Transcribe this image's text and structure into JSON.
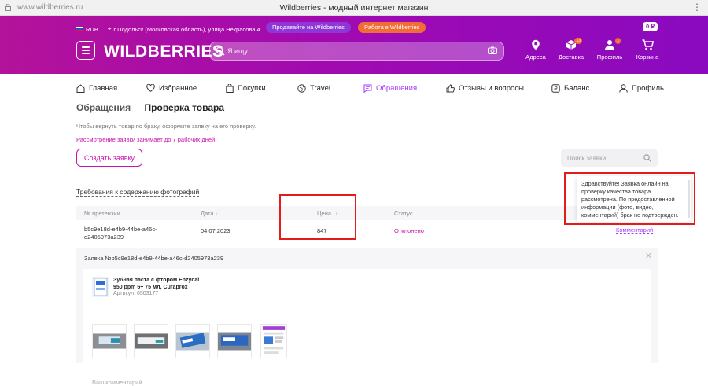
{
  "browser": {
    "url": "www.wildberries.ru",
    "title": "Wildberries - модный интернет магазин"
  },
  "header": {
    "currency": "RUB",
    "location": "г Подольск (Московская область), улица Некрасова 4",
    "sell_label": "Продавайте на Wildberries",
    "work_label": "Работа в Wildberries",
    "balance": "0 ₽",
    "logo": "WILDBERRIES",
    "search_placeholder": "Я ищу...",
    "nav": [
      {
        "label": "Адреса",
        "icon": "map-pin-icon"
      },
      {
        "label": "Доставка",
        "icon": "delivery-box-icon",
        "badge": "13"
      },
      {
        "label": "Профиль",
        "icon": "user-icon",
        "badge": "1"
      },
      {
        "label": "Корзина",
        "icon": "cart-icon"
      }
    ]
  },
  "mainnav": [
    {
      "label": "Главная",
      "icon": "home-icon"
    },
    {
      "label": "Избранное",
      "icon": "heart-icon"
    },
    {
      "label": "Покупки",
      "icon": "bag-icon"
    },
    {
      "label": "Travel",
      "icon": "globe-icon"
    },
    {
      "label": "Обращения",
      "icon": "message-icon",
      "active": true
    },
    {
      "label": "Отзывы и вопросы",
      "icon": "thumb-icon"
    },
    {
      "label": "Баланс",
      "icon": "wallet-icon"
    },
    {
      "label": "Профиль",
      "icon": "user-outline-icon"
    }
  ],
  "tabs": {
    "inactive": "Обращения",
    "active": "Проверка товара"
  },
  "info": {
    "line1": "Чтобы вернуть товар по браку, оформите заявку на его проверку.",
    "line2": "Рассмотрение заявки занимает до 7 рабочих дней."
  },
  "create_button": "Создать заявку",
  "search_claims_placeholder": "Поиск заявки",
  "requirements_link": "Требования к содержанию фотографий",
  "table": {
    "headers": {
      "claim": "№ претензии",
      "date": "Дата",
      "price": "Цена",
      "status": "Статус"
    },
    "row": {
      "claim_line1": "b5c9e18d-e4b9-44be-a46c-",
      "claim_line2": "d2405973a239",
      "date": "04.07.2023",
      "price": "847",
      "status": "Отклонено",
      "comment_link": "Комментарий"
    }
  },
  "details": {
    "title": "Заявка №b5c9e18d-e4b9-44be-a46c-d2405973a239",
    "product_line1": "Зубная паста с фтором Enzycal",
    "product_line2": "950 ppm 6+ 75 мл, Curaprox",
    "article": "Артикул: 6503177",
    "your_comment": "Ваш комментарий"
  },
  "tooltip": {
    "text": "Здравствуйте! Заявка онлайн на проверку качества товара рассмотрена. По предоставленной информации (фото, видео, комментарий) брак не подтвержден."
  },
  "colors": {
    "brand_start": "#b3129a",
    "brand_end": "#8a0ac0",
    "accent": "#cb11ab",
    "link_purple": "#a73afd",
    "annotation": "#e31b1b"
  }
}
